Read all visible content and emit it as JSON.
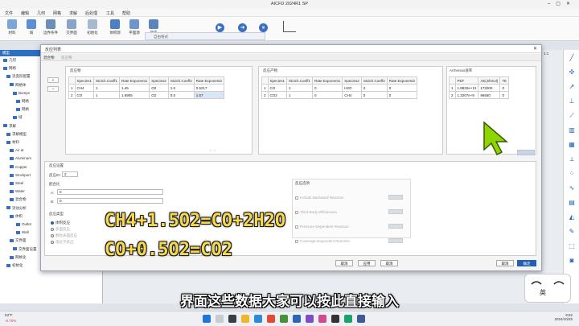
{
  "app": {
    "title": "AICFD 2024R1 SP",
    "menus": [
      "文件",
      "编辑",
      "几何",
      "网格",
      "求解",
      "后处理",
      "工具",
      "帮助"
    ],
    "ribbon": [
      "材料",
      "域",
      "边界条件",
      "交界面",
      "初始化",
      "体积源",
      "平面源",
      "风扇"
    ],
    "bg_dialog_title": "自由格式"
  },
  "left_panel": {
    "header": "模型",
    "tree": [
      "几何",
      "网格",
      "流变形配置",
      "网格体",
      "Bumps",
      "网格",
      "网格",
      "域",
      "求解",
      "求解模型",
      "材料",
      "Air at",
      "Aluminum",
      "Copper",
      "Stockport",
      "Steel",
      "Water",
      "混合物",
      "流动分析",
      "体积",
      "Outlet",
      "Wall",
      "交界面",
      "交界面设置",
      "网格化",
      "初始化"
    ]
  },
  "right_readout": "1:1",
  "dialog": {
    "title": "反应列表",
    "tabs": [
      "混合物",
      "反应物"
    ],
    "reactants": {
      "title": "反应物",
      "headers": [
        "",
        "Species1",
        "Stoich.Coeff1",
        "Rate Exponent1",
        "Species2",
        "Stoich.Coeff2",
        "Rate Exponent2"
      ],
      "rows": [
        [
          "1",
          "CH4",
          "1",
          "1.46",
          "O2",
          "1.5",
          "0.5217"
        ],
        [
          "2",
          "CO",
          "1",
          "1.6906",
          "O2",
          "0.5",
          "1.57"
        ]
      ]
    },
    "products": {
      "title": "反应产物",
      "headers": [
        "",
        "Species1",
        "Stoich.Coeff1",
        "Rate Exponent1",
        "Species2",
        "Stoich.Coeff2",
        "Rate Exponent2"
      ],
      "rows": [
        [
          "1",
          "CO",
          "1",
          "0",
          "H2O",
          "2",
          "0"
        ],
        [
          "2",
          "CO2",
          "1",
          "0",
          "CH4",
          "0",
          "0"
        ]
      ]
    },
    "arrhenius": {
      "title": "Arrhenius速率",
      "headers": [
        "",
        "PEF",
        "AE(J/kmol)",
        "TE"
      ],
      "rows": [
        [
          "1",
          "1.8832e+12",
          "172000",
          "0"
        ],
        [
          "2",
          "1.3207e+8",
          "96560",
          "0"
        ]
      ]
    },
    "settings": {
      "title": "反应设置",
      "id_label": "反应ID:",
      "id_value": "2",
      "coeff_title": "配合比",
      "a_label": "A:",
      "a_value": "0",
      "b_label": "B:",
      "b_value": "0",
      "type_title": "反应类型",
      "types": [
        "体积反应",
        "表面反应",
        "颗粒表面反应",
        "电化学反应"
      ]
    },
    "options": {
      "title": "反应选项",
      "items": [
        "Include Backward Reaction",
        "Third-Body Efficiencies",
        "Pressure-Dependent Reaction",
        "Coverage-Dependent Reaction"
      ]
    },
    "footer": {
      "cancel_top": "取消",
      "apply": "应用",
      "cancel": "取消",
      "ok": "确定",
      "cancel2": "取消"
    }
  },
  "overlay": {
    "eq1": "CH4+1.5O2=CO+2H2O",
    "eq2": "CO+0.5O2=CO2",
    "subtitle": "界面这些数据大家可以按此直接输入",
    "sticker_text": "英"
  },
  "taskbar": {
    "weather": "53°F",
    "weather_sub": "-0.70%",
    "time": "9:52",
    "date": "2024/10/25"
  },
  "colors": {
    "accent": "#1f5fb4",
    "caption": "#f5d94a",
    "cursor": "#8ed500"
  }
}
